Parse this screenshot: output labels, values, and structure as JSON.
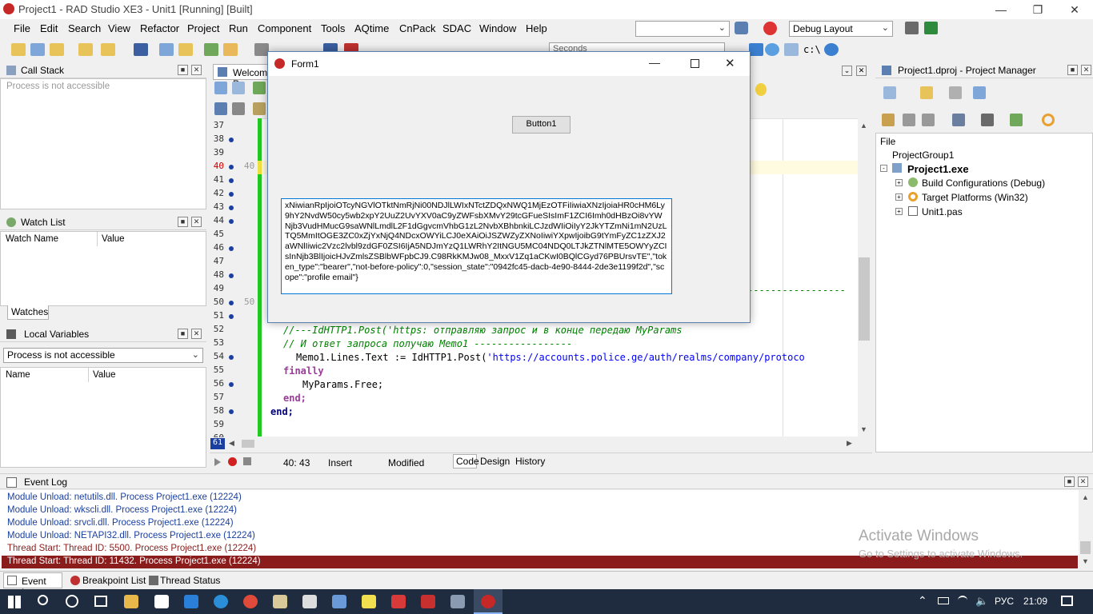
{
  "window": {
    "title": "Project1 - RAD Studio XE3 - Unit1 [Running] [Built]"
  },
  "menu": [
    "File",
    "Edit",
    "Search",
    "View",
    "Refactor",
    "Project",
    "Run",
    "Component",
    "Tools",
    "AQtime",
    "CnPack",
    "SDAC",
    "Window",
    "Help"
  ],
  "toolbar": {
    "layout_combo": "Debug Layout",
    "seconds_label": "Seconds",
    "empty_combo": ""
  },
  "call_stack": {
    "title": "Call Stack",
    "message": "Process is not accessible"
  },
  "watch_list": {
    "title": "Watch List",
    "col_name": "Watch Name",
    "col_value": "Value",
    "tab": "Watches"
  },
  "local_vars": {
    "title": "Local Variables",
    "combo": "Process is not accessible",
    "col_name": "Name",
    "col_value": "Value"
  },
  "editor": {
    "tab": "Welcome P",
    "line_numbers": [
      "37",
      "38",
      "39",
      "40",
      "41",
      "42",
      "43",
      "44",
      "45",
      "46",
      "47",
      "48",
      "49",
      "50",
      "51",
      "52",
      "53",
      "54",
      "55",
      "56",
      "57",
      "58",
      "59",
      "60",
      "61"
    ],
    "marker_40": "40",
    "marker_50": "50",
    "code": {
      "l52": "//---IdHTTP1.Post('https: отправляю запрос и в конце передаю MyParams",
      "l53": "// И ответ запроса получаю Memo1 -----------------",
      "l54a": "Memo1.Lines.Text := IdHTTP1.Post(",
      "l54b": "'https://accounts.police.ge/auth/realms/company/protoco",
      "l55": "finally",
      "l56": "MyParams.Free;",
      "l57": "end;",
      "l58": "end;",
      "l49dash": "-----------------"
    },
    "status": {
      "position": "40: 43",
      "mode": "Insert",
      "modified": "Modified"
    },
    "bottom_tabs": [
      "Code",
      "Design",
      "History"
    ]
  },
  "form1": {
    "title": "Form1",
    "button": "Button1",
    "memo": "xNiwianRpIjoiOTcyNGVlOTktNmRjNi00NDJlLWIxNTctZDQxNWQ1MjEzOTFiIiwiaXNzIjoiaHR0cHM6Ly9hY2NvdW50cy5wb2xpY2UuZ2UvYXV0aC9yZWFsbXMvY29tcGFueSIsImF1ZCI6Imh0dHBzOi8vYWNjb3VudHMucG9saWNlLmdlL2F1dGgvcmVhbG1zL2NvbXBhbnkiLCJzdWIiOiIyY2JkYTZmNi1mN2UzLTQ5MmItOGE3ZC0xZjYxNjQ4NDcxOWYiLCJ0eXAiOiJSZWZyZXNoIiwiYXpwIjoibG9tYmFyZC1zZXJ2aWNlIiwic2Vzc2lvbl9zdGF0ZSI6IjA5NDJmYzQ1LWRhY2ItNGU5MC04NDQ0LTJkZTNlMTE5OWYyZCIsInNjb3BlIjoicHJvZmlsZSBlbWFpbCJ9.C98RkKMJw08_MxxV1Zq1aCKwI0BQlCGyd76PBUrsvTE\",\"token_type\":\"bearer\",\"not-before-policy\":0,\"session_state\":\"0942fc45-dacb-4e90-8444-2de3e1199f2d\",\"scope\":\"profile email\"}"
  },
  "project_manager": {
    "title": "Project1.dproj - Project Manager",
    "file": "File",
    "group": "ProjectGroup1",
    "project": "Project1.exe",
    "items": [
      "Build Configurations (Debug)",
      "Target Platforms (Win32)",
      "Unit1.pas"
    ]
  },
  "event_log": {
    "title": "Event Log",
    "lines": [
      "Module Unload: netutils.dll. Process Project1.exe (12224)",
      "Module Unload: wkscli.dll. Process Project1.exe (12224)",
      "Module Unload: srvcli.dll. Process Project1.exe (12224)",
      "Module Unload: NETAPI32.dll. Process Project1.exe (12224)",
      "Thread Start: Thread ID: 5500. Process Project1.exe (12224)",
      "Thread Start: Thread ID: 11432. Process Project1.exe (12224)"
    ],
    "tabs": [
      "Event Log",
      "Breakpoint List",
      "Thread Status"
    ]
  },
  "watermark": {
    "line1": "Activate Windows",
    "line2": "Go to Settings to activate Windows."
  },
  "taskbar": {
    "lang": "РУС",
    "time": "21:09"
  },
  "colors": {
    "highlight_row": "#8b1c1c",
    "log_text": "#1a3fa0",
    "change_bar": "#23c923"
  }
}
